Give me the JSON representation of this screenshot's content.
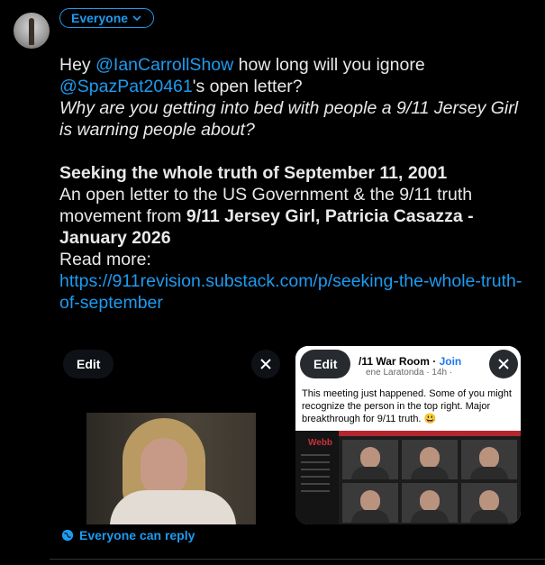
{
  "composer": {
    "audience_label": "Everyone",
    "reply_setting": "Everyone can reply"
  },
  "tweet": {
    "line1_pre": "Hey ",
    "mention1": "@IanCarrollShow",
    "line1_post": " how long will you ignore",
    "mention2": "@SpazPat20461",
    "line2_post": "'s open letter?",
    "italic_question": "Why are you getting into bed with people a 9/11 Jersey Girl is warning people about?",
    "heading": "Seeking the whole truth of September 11, 2001",
    "body_pre": "An open letter to the US Government & the 9/11 truth movement from ",
    "body_bold": "9/11 Jersey Girl, Patricia Casazza - January 2026",
    "read_more": "Read more:",
    "url": "https://911revision.substack.com/p/seeking-the-whole-truth-of-september"
  },
  "media": [
    {
      "edit_label": "Edit"
    },
    {
      "edit_label": "Edit",
      "group_name": "/11 War Room · ",
      "join": "Join",
      "author_line": "ene Laratonda · 14h · ",
      "post_text": "This meeting just happened. Some of you might recognize the person in the top right. Major breakthrough for 9/11 truth. 😃",
      "app_name": "Webb"
    }
  ],
  "colors": {
    "accent": "#1d9bf0",
    "background": "#000000",
    "text": "#e7e9ea"
  }
}
